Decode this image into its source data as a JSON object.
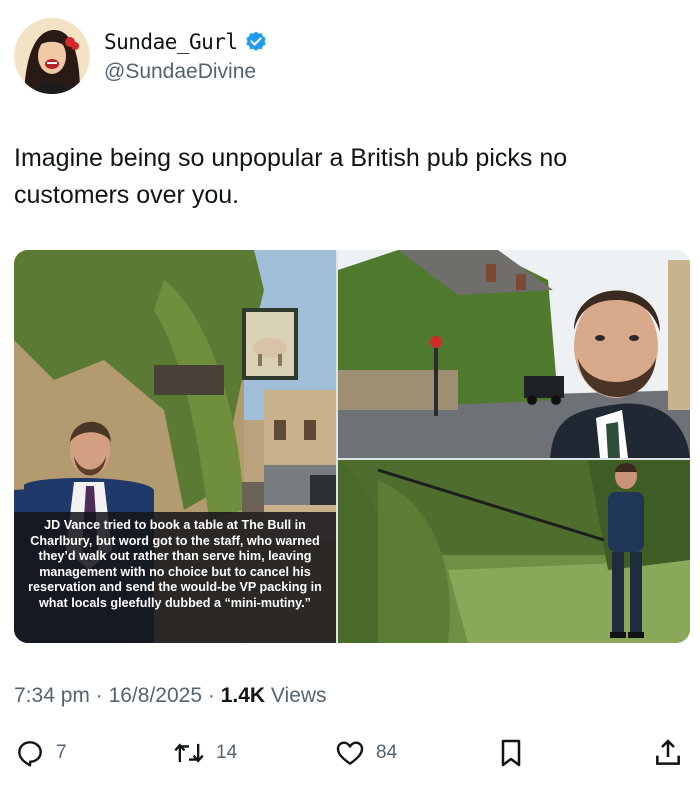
{
  "author": {
    "display_name": "Sundae_Gurl",
    "handle": "@SundaeDivine",
    "verified": true
  },
  "tweet": {
    "text": "Imagine being so unpopular a British pub picks no customers over you."
  },
  "media": {
    "caption": "JD Vance tried to book a table at The Bull in Charlbury, but word got to the staff, who warned they’d walk out rather than serve him, leaving management with no choice but to cancel his reservation and send the would-be VP packing in what locals gleefully dubbed a “mini-mutiny.”"
  },
  "meta": {
    "time": "7:34 pm",
    "date": "16/8/2025",
    "views_count": "1.4K",
    "views_label": "Views"
  },
  "actions": {
    "replies": "7",
    "retweets": "14",
    "likes": "84"
  },
  "icons": {
    "verified": "verified-badge-icon",
    "reply": "reply-icon",
    "retweet": "retweet-icon",
    "like": "heart-icon",
    "bookmark": "bookmark-icon",
    "share": "share-icon"
  },
  "colors": {
    "verified_blue": "#1d9bf0",
    "text_primary": "#0f1419",
    "text_secondary": "#536471"
  }
}
